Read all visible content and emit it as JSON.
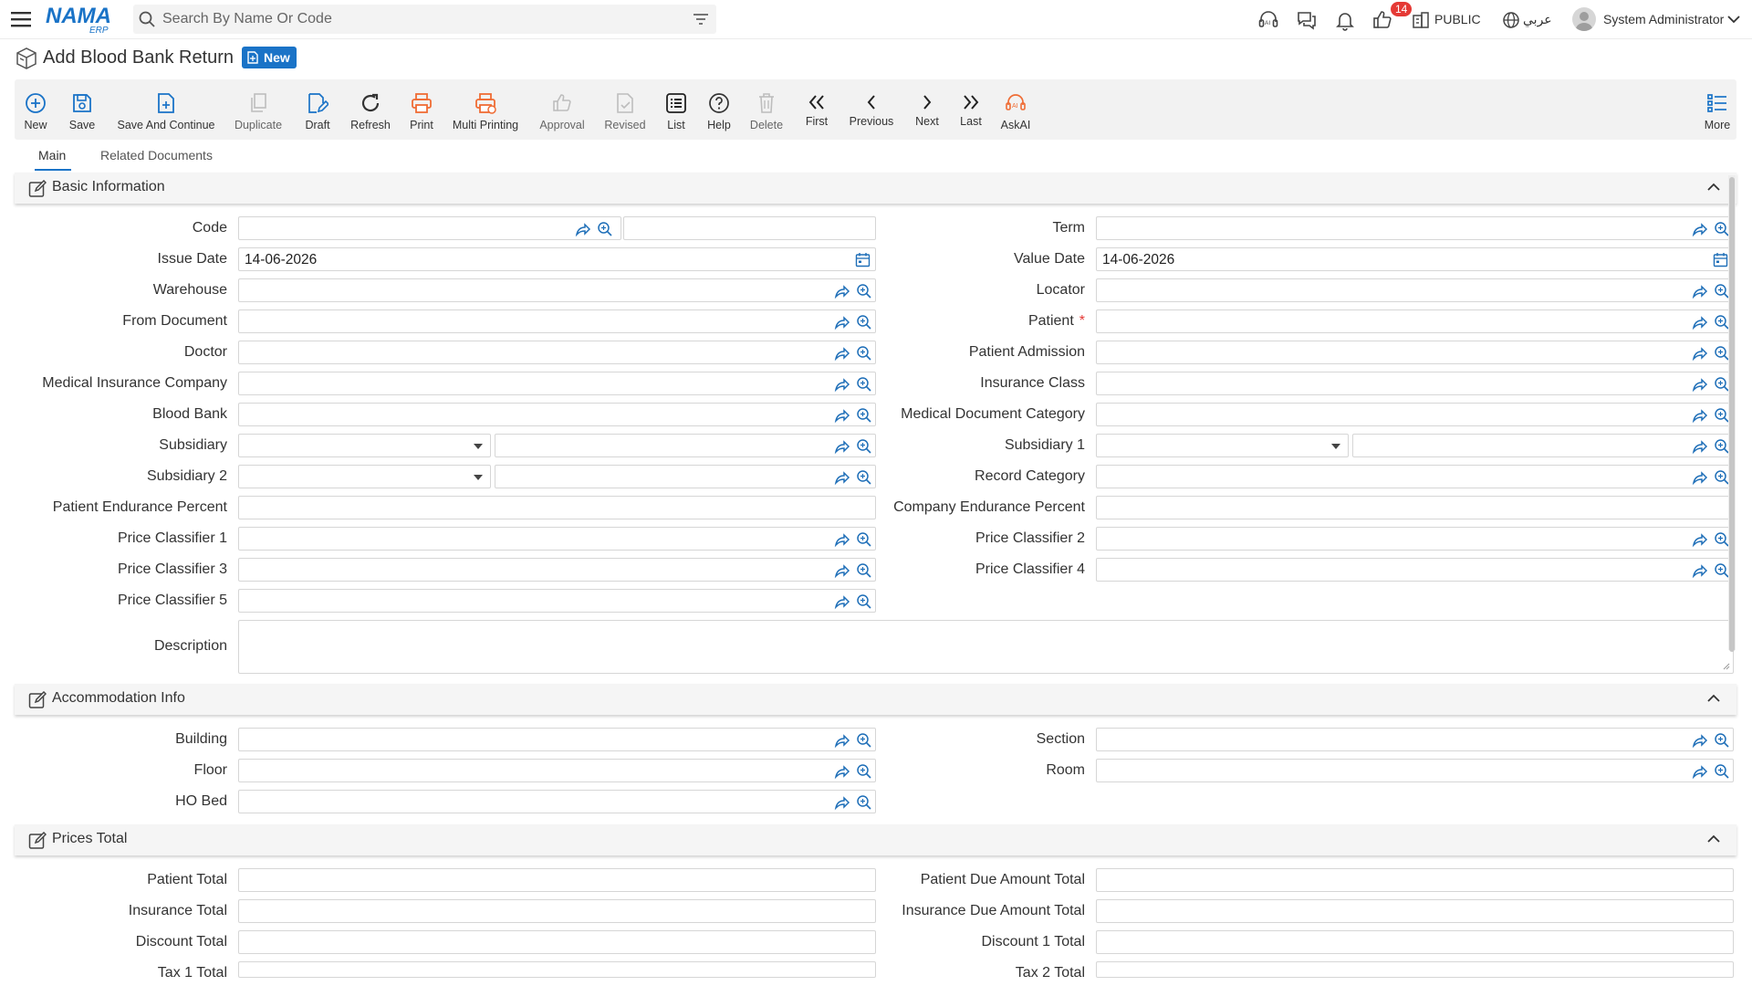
{
  "topbar": {
    "search_placeholder": "Search By Name Or Code",
    "notification_count": "14",
    "branch_label": "PUBLIC",
    "language_label": "عربي",
    "user_name": "System Administrator",
    "icons": [
      "menu-icon",
      "logo",
      "search-icon",
      "filter-icon",
      "ai-headset-icon",
      "chat-icon",
      "bell-icon",
      "thumbs-up-icon",
      "building-icon",
      "globe-icon",
      "user-avatar",
      "chevron-down-icon"
    ]
  },
  "page": {
    "title": "Add Blood Bank Return",
    "status_badge": "New"
  },
  "toolbar": {
    "new": "New",
    "save": "Save",
    "save_continue": "Save And Continue",
    "duplicate": "Duplicate",
    "draft": "Draft",
    "refresh": "Refresh",
    "print": "Print",
    "multi_printing": "Multi Printing",
    "approval": "Approval",
    "revised": "Revised",
    "list": "List",
    "help": "Help",
    "delete": "Delete",
    "first": "First",
    "previous": "Previous",
    "next": "Next",
    "last": "Last",
    "askai": "AskAI",
    "more": "More"
  },
  "tabs": [
    "Main",
    "Related Documents"
  ],
  "sections": {
    "basic": {
      "title": "Basic Information",
      "code": "Code",
      "term": "Term",
      "issue_date": "Issue Date",
      "issue_date_value": "14-06-2026",
      "value_date": "Value Date",
      "value_date_value": "14-06-2026",
      "warehouse": "Warehouse",
      "locator": "Locator",
      "from_document": "From Document",
      "patient": "Patient",
      "patient_required": "*",
      "doctor": "Doctor",
      "patient_admission": "Patient Admission",
      "medical_insurance_company": "Medical Insurance Company",
      "insurance_class": "Insurance Class",
      "blood_bank": "Blood Bank",
      "medical_document_category": "Medical Document Category",
      "subsidiary": "Subsidiary",
      "subsidiary_1": "Subsidiary 1",
      "subsidiary_2": "Subsidiary 2",
      "record_category": "Record Category",
      "patient_endurance_percent": "Patient Endurance Percent",
      "company_endurance_percent": "Company Endurance Percent",
      "price_classifier_1": "Price Classifier 1",
      "price_classifier_2": "Price Classifier 2",
      "price_classifier_3": "Price Classifier 3",
      "price_classifier_4": "Price Classifier 4",
      "price_classifier_5": "Price Classifier 5",
      "description": "Description"
    },
    "accommodation": {
      "title": "Accommodation Info",
      "building": "Building",
      "section": "Section",
      "floor": "Floor",
      "room": "Room",
      "ho_bed": "HO Bed"
    },
    "prices": {
      "title": "Prices Total",
      "patient_total": "Patient Total",
      "patient_due_amount_total": "Patient Due Amount Total",
      "insurance_total": "Insurance Total",
      "insurance_due_amount_total": "Insurance Due Amount Total",
      "discount_total": "Discount Total",
      "discount_1_total": "Discount 1 Total",
      "tax_1_total": "Tax 1 Total",
      "tax_2_total": "Tax 2 Total"
    }
  },
  "colors": {
    "accent": "#1a73c7",
    "print_orange": "#ef6c34",
    "required_red": "#e53935"
  }
}
